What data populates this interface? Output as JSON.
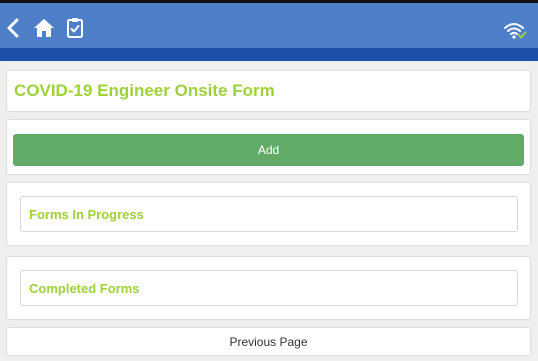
{
  "header": {
    "back_icon": "chevron-left-icon",
    "home_icon": "home-icon",
    "clipboard_icon": "clipboard-check-icon",
    "wifi_icon": "wifi-connected-icon",
    "bar_color": "#4f7fc8",
    "sub_bar_color": "#1e4fa8"
  },
  "form": {
    "title": "COVID-19 Engineer Onsite Form",
    "title_color": "#9ed13a"
  },
  "actions": {
    "add_label": "Add",
    "add_color": "#62ab67"
  },
  "sections": {
    "in_progress_label": "Forms In Progress",
    "completed_label": "Completed Forms"
  },
  "footer": {
    "previous_label": "Previous Page"
  }
}
